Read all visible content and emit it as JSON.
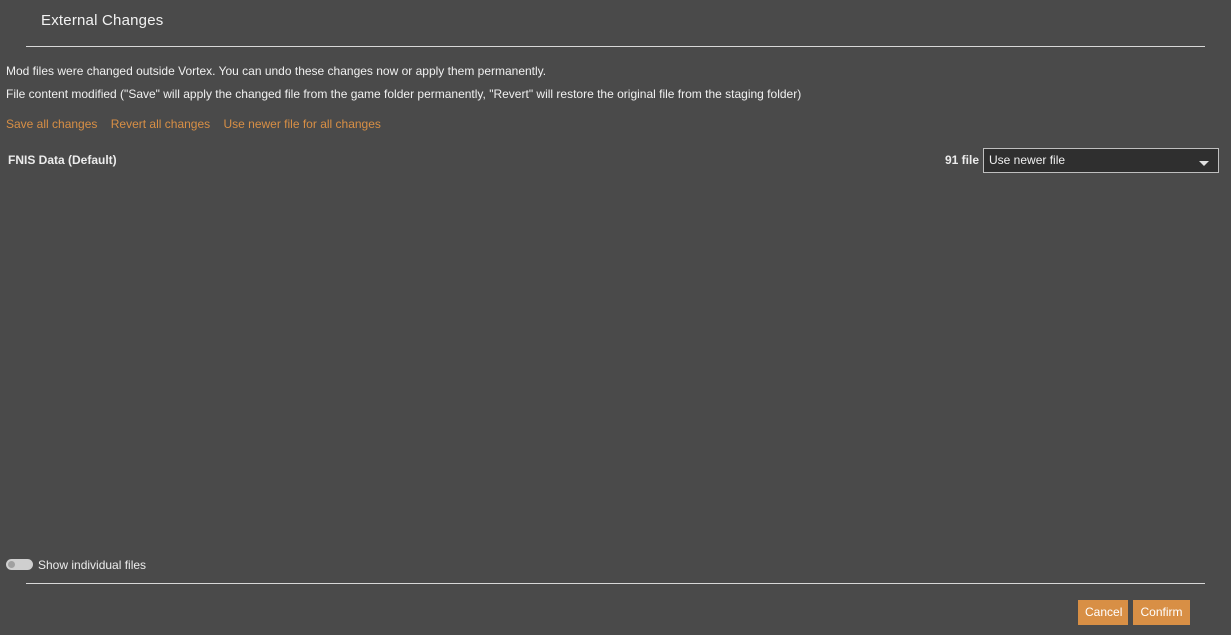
{
  "dialog": {
    "title": "External Changes"
  },
  "message": {
    "line1": "Mod files were changed outside Vortex. You can undo these changes now or apply them permanently.",
    "line2": "File content modified (\"Save\" will apply the changed file from the game folder permanently, \"Revert\" will restore the original file from the staging folder)"
  },
  "actions": {
    "save_all": "Save all changes",
    "revert_all": "Revert all changes",
    "use_newer_all": "Use newer file for all changes"
  },
  "mod": {
    "name": "FNIS Data (Default)",
    "file_count": "91 file",
    "selected_action": "Use newer file"
  },
  "toggle": {
    "label": "Show individual files",
    "state": "off"
  },
  "footer": {
    "cancel_label": "Cancel",
    "confirm_label": "Confirm"
  },
  "colors": {
    "background": "#4a4a4a",
    "accent": "#d88f45",
    "select_background": "#2f2f2f"
  }
}
